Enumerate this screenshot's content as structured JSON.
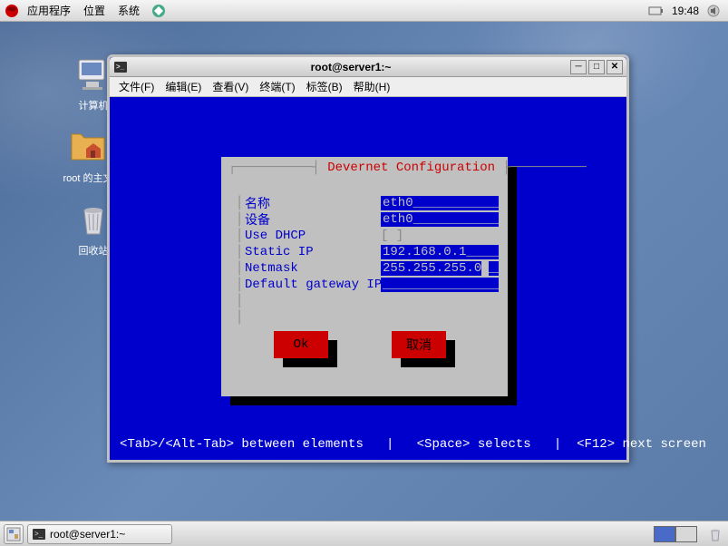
{
  "top_panel": {
    "menus": [
      "应用程序",
      "位置",
      "系统"
    ],
    "clock": "19:48"
  },
  "desktop_icons": {
    "computer": "计算机",
    "home": "root 的主文",
    "trash": "回收站"
  },
  "window": {
    "title": "root@server1:~",
    "menubar": {
      "file": "文件(F)",
      "edit": "编辑(E)",
      "view": "查看(V)",
      "terminal": "终端(T)",
      "tabs": "标签(B)",
      "help": "帮助(H)"
    }
  },
  "tui": {
    "title": "Devernet Configuration",
    "fields": {
      "name": {
        "label": "名称",
        "value": "eth0"
      },
      "device": {
        "label": "设备",
        "value": "eth0"
      },
      "dhcp": {
        "label": "Use DHCP",
        "checkbox": "[ ]"
      },
      "static_ip": {
        "label": "Static IP",
        "value": "192.168.0.1"
      },
      "netmask": {
        "label": "Netmask",
        "value": "255.255.255.0"
      },
      "gateway": {
        "label": "Default gateway IP",
        "value": ""
      }
    },
    "buttons": {
      "ok": "Ok",
      "cancel": "取消"
    },
    "footer": "<Tab>/<Alt-Tab> between elements   |   <Space> selects   |  <F12> next screen"
  },
  "taskbar": {
    "task": "root@server1:~"
  }
}
